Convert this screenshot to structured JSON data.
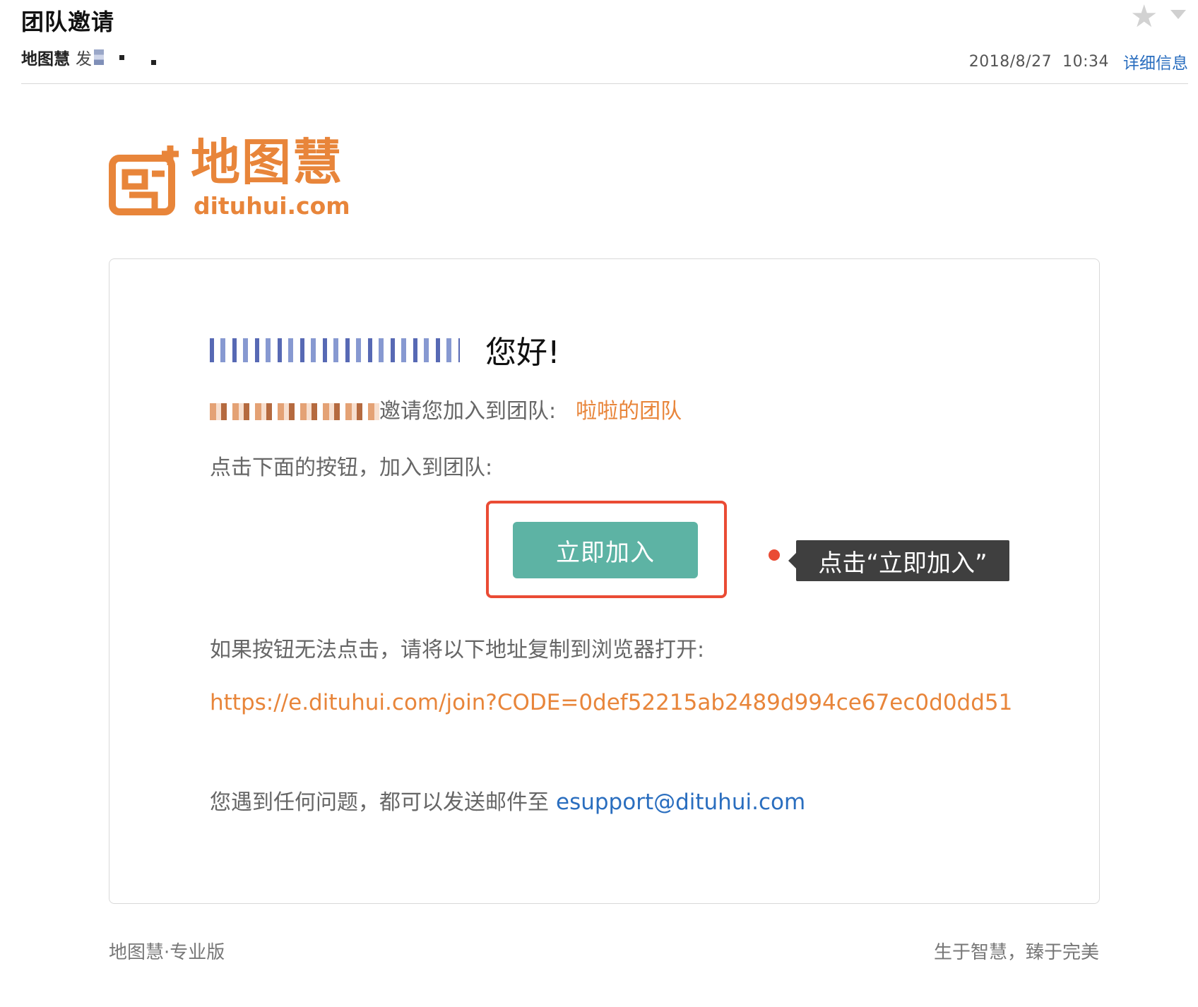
{
  "header": {
    "subject": "团队邀请",
    "sender_name": "地图慧",
    "sender_verb": "发",
    "date": "2018/8/27",
    "time": "10:34",
    "details_label": "详细信息",
    "star_icon": "star-icon",
    "menu_icon": "caret-down-icon"
  },
  "logo": {
    "name": "地图慧",
    "domain": "dituhui.com",
    "color": "#e8853a"
  },
  "card": {
    "greeting": "您好!",
    "invite_text": "邀请您加入到团队:",
    "team_name": "啦啦的团队",
    "instruction": "点击下面的按钮，加入到团队:",
    "join_button_label": "立即加入",
    "callout_text": "点击“立即加入”",
    "fallback_note": "如果按钮无法点击，请将以下地址复制到浏览器打开:",
    "join_url": "https://e.dituhui.com/join?CODE=0def52215ab2489d994ce67ec0d0dd51",
    "support_text": "您遇到任何问题，都可以发送邮件至",
    "support_email": "esupport@dituhui.com"
  },
  "footer": {
    "left": "地图慧·专业版",
    "right": "生于智慧，臻于完美"
  },
  "colors": {
    "accent_orange": "#e8853a",
    "button_teal": "#5db3a4",
    "highlight_red": "#ea4b34",
    "link_blue": "#2a6ebf"
  }
}
